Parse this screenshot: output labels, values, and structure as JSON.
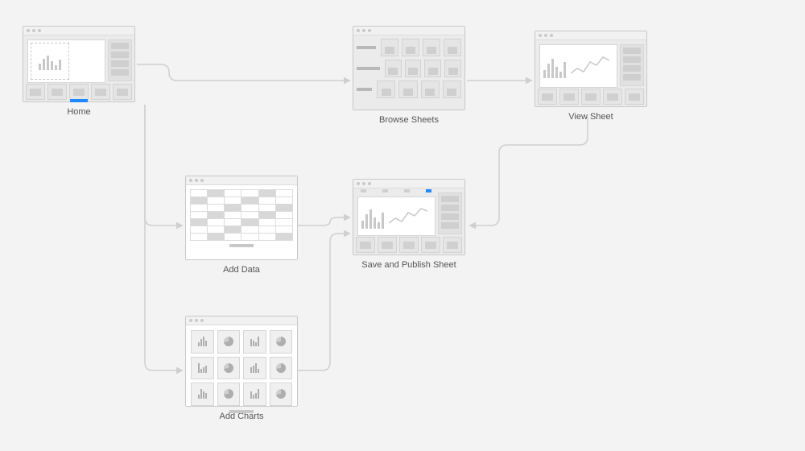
{
  "nodes": {
    "home": {
      "label": "Home"
    },
    "browse": {
      "label": "Browse Sheets"
    },
    "view": {
      "label": "View Sheet"
    },
    "adddata": {
      "label": "Add Data"
    },
    "save": {
      "label": "Save and Publish Sheet"
    },
    "addcharts": {
      "label": "Add Charts"
    }
  },
  "flow_edges": [
    [
      "home",
      "browse"
    ],
    [
      "browse",
      "view"
    ],
    [
      "home",
      "adddata"
    ],
    [
      "home",
      "addcharts"
    ],
    [
      "adddata",
      "save"
    ],
    [
      "addcharts",
      "save"
    ],
    [
      "view",
      "save"
    ]
  ],
  "colors": {
    "accent": "#1e88ff",
    "line": "#cfcfcf",
    "bg": "#f3f3f3"
  }
}
